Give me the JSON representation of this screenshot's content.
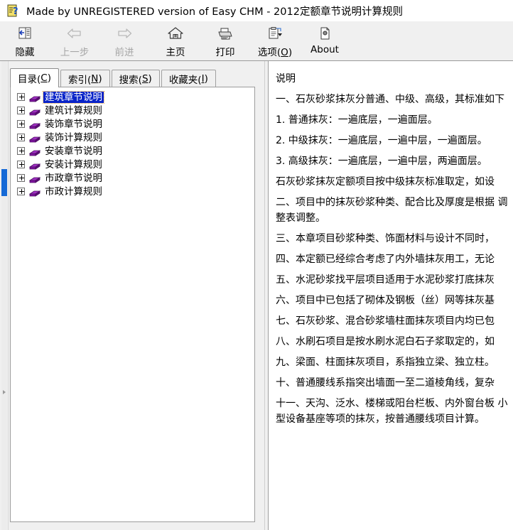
{
  "window": {
    "title": "Made by UNREGISTERED version of Easy CHM - 2012定额章节说明计算规则",
    "icon": "help-document-icon"
  },
  "toolbar": {
    "buttons": [
      {
        "label": "隐藏",
        "icon": "hide-pane-icon",
        "disabled": false
      },
      {
        "label": "上一步",
        "icon": "back-arrow-icon",
        "disabled": true
      },
      {
        "label": "前进",
        "icon": "forward-arrow-icon",
        "disabled": true
      },
      {
        "label": "主页",
        "icon": "home-icon",
        "disabled": false
      },
      {
        "label": "打印",
        "icon": "printer-icon",
        "disabled": false
      },
      {
        "label": "选项(O)",
        "icon": "options-clipboard-icon",
        "disabled": false
      },
      {
        "label": "About",
        "icon": "about-page-icon",
        "disabled": false
      }
    ]
  },
  "sidebar": {
    "tabs": [
      {
        "label": "目录(C)",
        "text": "目录(",
        "accel": "C",
        "tail": ")",
        "active": true
      },
      {
        "label": "索引(N)",
        "text": "索引(",
        "accel": "N",
        "tail": ")",
        "active": false
      },
      {
        "label": "搜索(S)",
        "text": "搜索(",
        "accel": "S",
        "tail": ")",
        "active": false
      },
      {
        "label": "收藏夹(I)",
        "text": "收藏夹(",
        "accel": "I",
        "tail": ")",
        "active": false
      }
    ],
    "tree": [
      {
        "label": "建筑章节说明",
        "selected": true
      },
      {
        "label": "建筑计算规则",
        "selected": false
      },
      {
        "label": "装饰章节说明",
        "selected": false
      },
      {
        "label": "装饰计算规则",
        "selected": false
      },
      {
        "label": "安装章节说明",
        "selected": false
      },
      {
        "label": "安装计算规则",
        "selected": false
      },
      {
        "label": "市政章节说明",
        "selected": false
      },
      {
        "label": "市政计算规则",
        "selected": false
      }
    ]
  },
  "content": {
    "heading": "说明",
    "paragraphs": [
      "一、石灰砂浆抹灰分普通、中级、高级，其标准如下",
      "1. 普通抹灰：一遍底层，一遍面层。",
      "2. 中级抹灰：一遍底层，一遍中层，一遍面层。",
      "3. 高级抹灰：一遍底层，一遍中层，两遍面层。",
      "石灰砂浆抹灰定额项目按中级抹灰标准取定，如设",
      "二、项目中的抹灰砂浆种类、配合比及厚度是根据\n调整表调整。",
      "三、本章项目砂浆种类、饰面材料与设计不同时，",
      "四、本定额已经综合考虑了内外墙抹灰用工，无论",
      "五、水泥砂浆找平层项目适用于水泥砂浆打底抹灰",
      "六、项目中已包括了砌体及钢板（丝）网等抹灰基",
      "七、石灰砂浆、混合砂浆墙柱面抹灰项目内均已包",
      "八、水刷石项目是按水刷水泥白石子浆取定的，如",
      "九、梁面、柱面抹灰项目，系指独立梁、独立柱。",
      "十、普通腰线系指突出墙面一至二道棱角线，复杂",
      "十一、天沟、泛水、楼梯或阳台栏板、内外窗台板\n小型设备基座等项的抹灰，按普通腰线项目计算。"
    ]
  },
  "colors": {
    "selection_blue": "#0a24c8",
    "scrollbar_blue": "#1569d6",
    "book_purple": "#8f1fb0",
    "toolbar_bg": "#f0f0f0"
  }
}
